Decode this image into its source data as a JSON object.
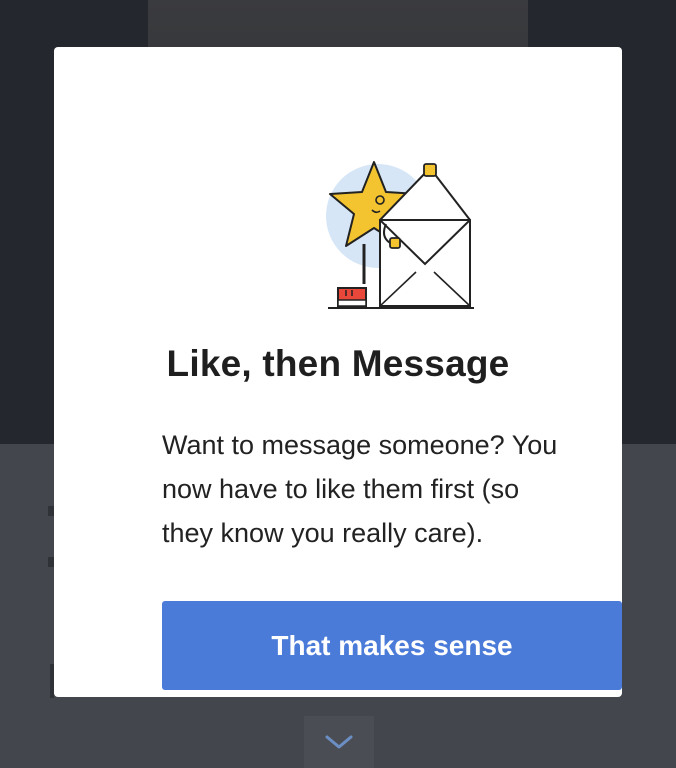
{
  "modal": {
    "title": "Like, then Message",
    "body_lines": [
      "Want to message someone? You",
      "now have to like them first (so",
      "they know you really care)."
    ],
    "button_label": "That makes sense",
    "illustration": "star-opening-envelope-illustration"
  },
  "background": {
    "chevron_icon": "chevron-down-icon"
  },
  "colors": {
    "button": "#4b7bd9",
    "star": "#f4c430",
    "shoe": "#e8473a",
    "illustration_circle": "#d6e6f7",
    "backdrop_top": "#24272d",
    "backdrop_bottom": "#43474d"
  }
}
